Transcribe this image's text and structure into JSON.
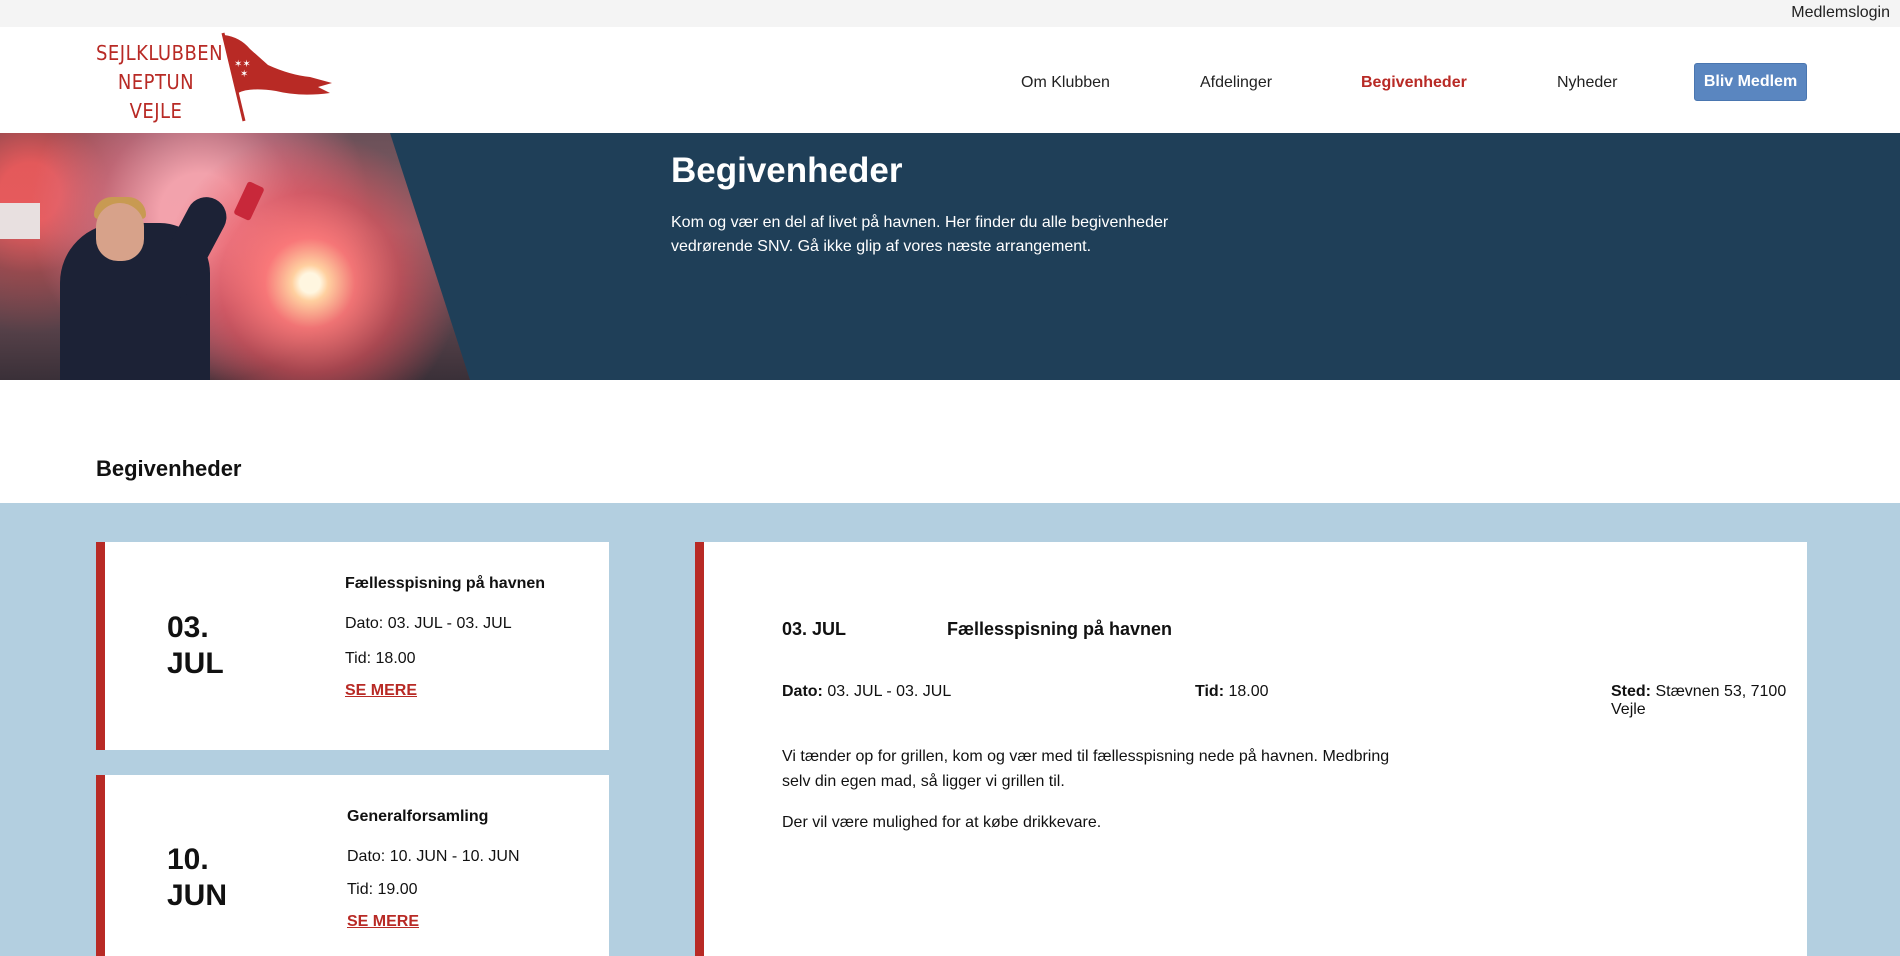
{
  "topbar": {
    "login_label": "Medlemslogin"
  },
  "logo": {
    "lines": [
      "SEJLKLUBBEN",
      "NEPTUN",
      "VEJLE"
    ],
    "brand_color": "#b82a25"
  },
  "nav": {
    "items": [
      {
        "label": "Om Klubben",
        "active": false
      },
      {
        "label": "Afdelinger",
        "active": false
      },
      {
        "label": "Begivenheder",
        "active": true
      },
      {
        "label": "Nyheder",
        "active": false
      }
    ],
    "cta_label": "Bliv Medlem"
  },
  "hero": {
    "title": "Begivenheder",
    "text": "Kom og vær en del af livet på havnen. Her finder du alle begivenheder vedrørende SNV. Gå ikke glip af vores næste arrangement."
  },
  "section": {
    "title": "Begivenheder"
  },
  "events": [
    {
      "day": "03.",
      "month": "JUL",
      "title": "Fællesspisning på havnen",
      "date_line": "Dato: 03. JUL - 03. JUL",
      "time_line": "Tid: 18.00",
      "more_label": "SE MERE"
    },
    {
      "day": "10.",
      "month": "JUN",
      "title": "Generalforsamling",
      "date_line": "Dato: 10. JUN - 10. JUN",
      "time_line": "Tid: 19.00",
      "more_label": "SE MERE"
    }
  ],
  "detail": {
    "date": "03. JUL",
    "title": "Fællesspisning på havnen",
    "date_label": "Dato:",
    "date_value": "03. JUL - 03. JUL",
    "time_label": "Tid:",
    "time_value": "18.00",
    "place_label": "Sted:",
    "place_value": "Stævnen 53, 7100 Vejle",
    "paragraphs": [
      "Vi tænder op for grillen, kom og vær med til fællesspisning nede på havnen. Medbring selv din egen mad, så ligger vi grillen til.",
      "Der vil være mulighed for at købe drikkevare."
    ]
  },
  "colors": {
    "accent": "#b82a25",
    "hero_bg": "#1f3f58",
    "events_bg": "#b3cfe0",
    "button_bg": "#5a86c0"
  }
}
